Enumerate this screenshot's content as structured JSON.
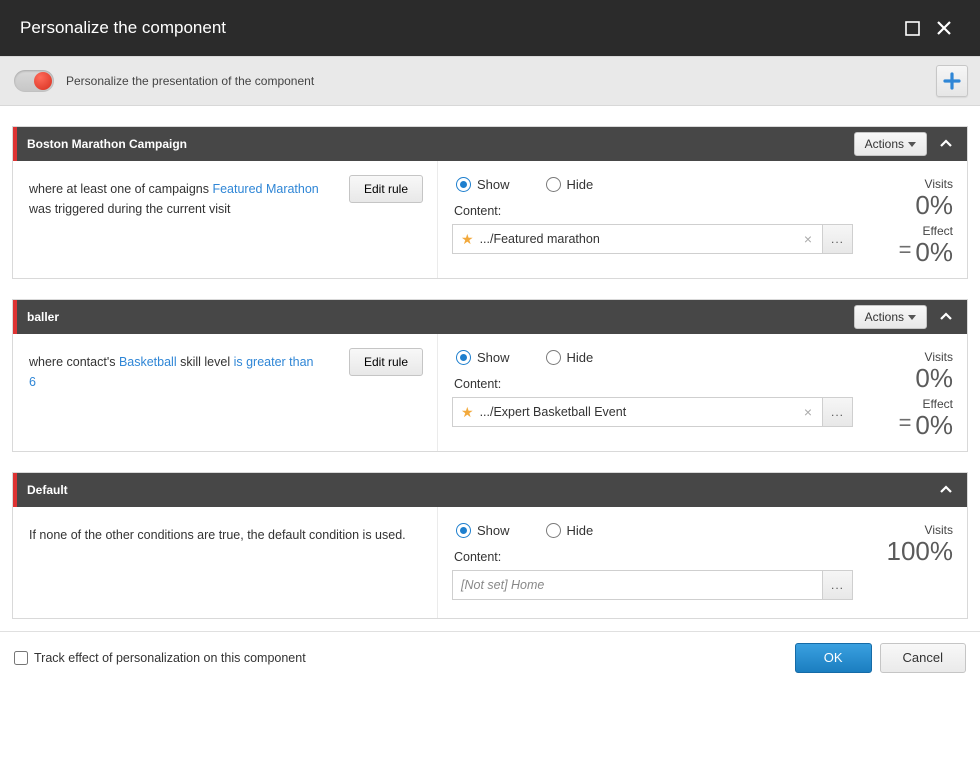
{
  "dialog": {
    "title": "Personalize the component"
  },
  "subbar": {
    "text": "Personalize the presentation of the component"
  },
  "common": {
    "actions_label": "Actions",
    "edit_rule_label": "Edit rule",
    "show_label": "Show",
    "hide_label": "Hide",
    "content_label": "Content:",
    "browse_ellipsis": "...",
    "clear_glyph": "×",
    "visits_label": "Visits",
    "effect_label": "Effect",
    "equals_glyph": "="
  },
  "panels": {
    "boston": {
      "title": "Boston Marathon Campaign",
      "rule": {
        "prefix": "where at least one of campaigns ",
        "link": "Featured Marathon",
        "suffix": " was triggered during the current visit"
      },
      "content_value": ".../Featured marathon",
      "visits": "0%",
      "effect": "0%"
    },
    "baller": {
      "title": "baller",
      "rule": {
        "prefix": "where contact's ",
        "link1": "Basketball",
        "mid": " skill level ",
        "link2": "is greater than 6"
      },
      "content_value": ".../Expert Basketball Event",
      "visits": "0%",
      "effect": "0%"
    },
    "default": {
      "title": "Default",
      "desc": "If none of the other conditions are true, the default condition is used.",
      "content_placeholder": "[Not set] Home",
      "visits": "100%"
    }
  },
  "footer": {
    "track_label": "Track effect of personalization on this component",
    "ok": "OK",
    "cancel": "Cancel"
  }
}
